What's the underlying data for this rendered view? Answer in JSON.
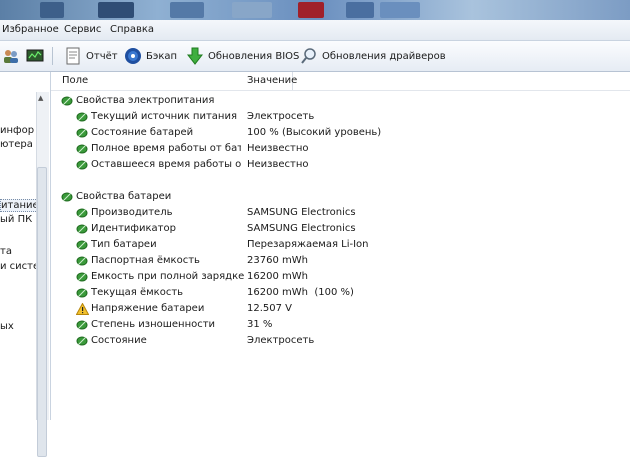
{
  "menu": {
    "items": [
      {
        "label": "Избранное"
      },
      {
        "label": "Сервис"
      },
      {
        "label": "Справка"
      }
    ]
  },
  "toolbar": {
    "report_label": "Отчёт",
    "backup_label": "Бэкап",
    "bios_label": "Обновления BIOS",
    "drivers_label": "Обновления драйверов"
  },
  "left_pane": {
    "lines": [
      "инфор",
      "ютера",
      "итание",
      "ый ПК",
      "та",
      "и систем",
      "ых"
    ]
  },
  "table": {
    "col_field": "Поле",
    "col_value": "Значение",
    "group1": {
      "title": "Свойства электропитания",
      "rows": [
        {
          "field": "Текущий источник питания",
          "value": "Электросеть"
        },
        {
          "field": "Состояние батарей",
          "value": "100 % (Высокий уровень)"
        },
        {
          "field": "Полное время работы от бата...",
          "value": "Неизвестно"
        },
        {
          "field": "Оставшееся время работы от ...",
          "value": "Неизвестно"
        }
      ]
    },
    "group2": {
      "title": "Свойства батареи",
      "rows": [
        {
          "field": "Производитель",
          "value": "SAMSUNG Electronics"
        },
        {
          "field": "Идентификатор",
          "value": "SAMSUNG Electronics"
        },
        {
          "field": "Тип батареи",
          "value": "Перезаряжаемая Li-Ion"
        },
        {
          "field": "Паспортная ёмкость",
          "value": "23760 mWh"
        },
        {
          "field": "Ёмкость при полной зарядке",
          "value": "16200 mWh"
        },
        {
          "field": "Текущая ёмкость",
          "value": "16200 mWh  (100 %)"
        },
        {
          "field": "Напряжение батареи",
          "value": "12.507 V",
          "warning": true
        },
        {
          "field": "Степень изношенности",
          "value": "31 %"
        },
        {
          "field": "Состояние",
          "value": "Электросеть"
        }
      ]
    }
  },
  "colors": {
    "toolbar_bg": "#e6ecf4",
    "accent": "#2f6fb3",
    "leaf_green": "#3a9a3a",
    "warning": "#e8a317"
  },
  "icons": {
    "report": "report-icon",
    "backup": "backup-disc-icon",
    "bios": "green-arrow-down-icon",
    "drivers": "magnifier-icon",
    "battery_item": "green-leaf-battery-icon",
    "warning": "warning-triangle-icon"
  }
}
